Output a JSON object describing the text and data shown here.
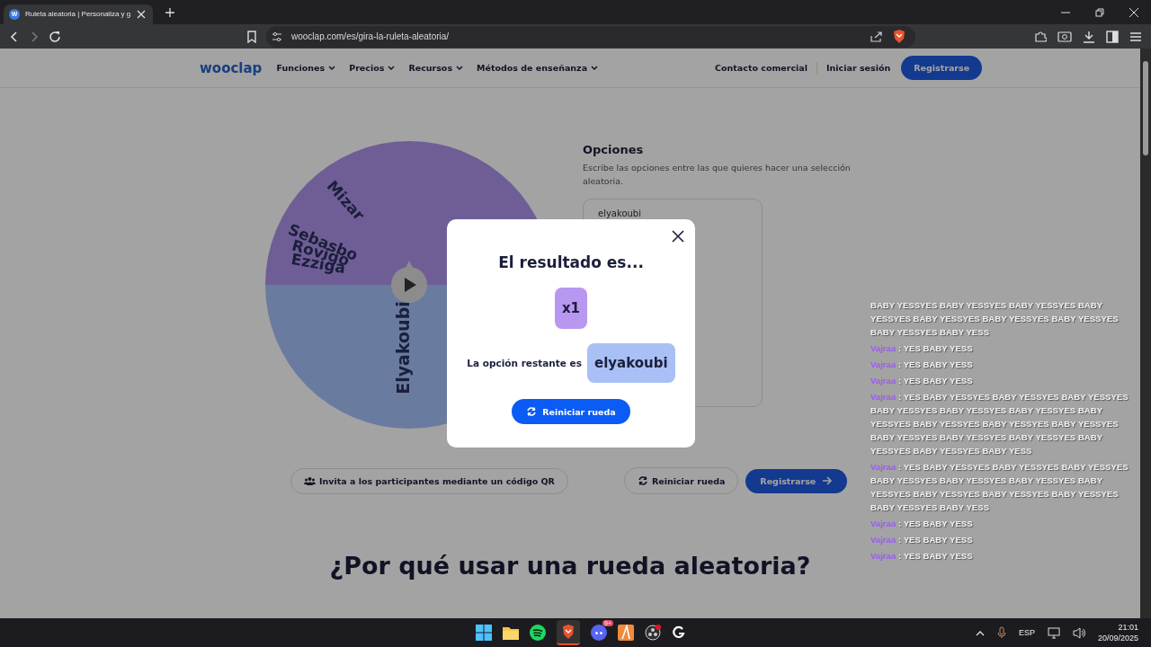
{
  "browser": {
    "favicon": "W",
    "tab_title": "Ruleta aleatoria | Personaliza y g",
    "url": "wooclap.com/es/gira-la-ruleta-aleatoria/"
  },
  "nav": {
    "logo": "wooclap",
    "items": [
      {
        "label": "Funciones"
      },
      {
        "label": "Precios"
      },
      {
        "label": "Recursos"
      },
      {
        "label": "Métodos de enseñanza"
      }
    ],
    "contact": "Contacto comercial",
    "login": "Iniciar sesión",
    "signup": "Registrarse"
  },
  "wheel": {
    "segments": [
      {
        "color": "#6f5e96",
        "labels": [
          "Mizar",
          "Sebasbo",
          "Rovigo",
          "Ezziga"
        ]
      },
      {
        "color": "#6a7ba0",
        "labels": [
          "Elyakoubi"
        ]
      }
    ]
  },
  "options": {
    "title": "Opciones",
    "description": "Escribe las opciones entre las que quieres hacer una selección aleatoria.",
    "entries": [
      "elyakoubi"
    ]
  },
  "modal": {
    "title": "El resultado es...",
    "count": "x1",
    "remaining_label": "La opción restante es",
    "remaining_value": "elyakoubi",
    "button": "Reiniciar rueda"
  },
  "actions": {
    "invite": "Invita a los participantes mediante un código QR",
    "restart": "Reiniciar rueda",
    "signup": "Registrarse"
  },
  "section_heading": "¿Por qué usar una rueda aleatoria?",
  "chat": [
    {
      "text": "BABY YESSYES BABY YESSYES BABY YESSYES BABY YESSYES BABY YESSYES BABY YESSYES BABY YESSYES BABY YESSYES BABY YESS"
    },
    {
      "user": "Vajraa",
      "text": ": YES BABY YESS"
    },
    {
      "user": "Vajraa",
      "text": ": YES BABY YESS"
    },
    {
      "user": "Vajraa",
      "text": ": YES BABY YESS"
    },
    {
      "user": "Vajraa",
      "text": ": YES BABY YESSYES BABY YESSYES BABY YESSYES BABY YESSYES BABY YESSYES BABY YESSYES BABY YESSYES BABY YESSYES BABY YESSYES BABY YESSYES BABY YESSYES BABY YESSYES BABY YESSYES BABY YESSYES BABY YESSYES BABY YESS"
    },
    {
      "user": "Vajraa",
      "text": ": YES BABY YESSYES BABY YESSYES BABY YESSYES BABY YESSYES BABY YESSYES BABY YESSYES BABY YESSYES BABY YESSYES BABY YESSYES BABY YESSYES BABY YESSYES BABY YESS"
    },
    {
      "user": "Vajraa",
      "text": ": YES BABY YESS"
    },
    {
      "user": "Vajraa",
      "text": ": YES BABY YESS"
    },
    {
      "user": "Vajraa",
      "text": ": YES BABY YESS"
    }
  ],
  "taskbar": {
    "discord_badge": "9+",
    "language": "ESP",
    "time": "21:01",
    "date": "20/09/2025"
  }
}
